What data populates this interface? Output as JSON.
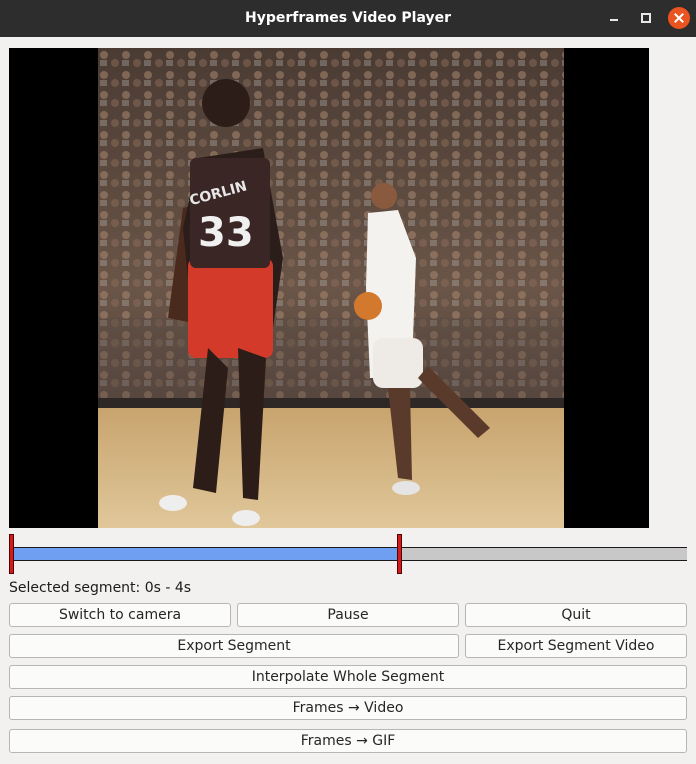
{
  "window": {
    "title": "Hyperframes Video Player",
    "controls": [
      "minimize-icon",
      "maximize-icon",
      "close-icon"
    ]
  },
  "player": {
    "jersey_name": "CORLIN",
    "jersey_number": "33"
  },
  "timeline": {
    "progress_fraction": 0.576,
    "segment_start_fraction": 0.0,
    "segment_end_fraction": 0.576,
    "fill_color": "#6f9ff0",
    "handle_color": "#d11c1c"
  },
  "segment": {
    "label": "Selected segment: 0s - 4s"
  },
  "buttons": {
    "switch_camera": "Switch to camera",
    "pause": "Pause",
    "quit": "Quit",
    "export_segment": "Export Segment",
    "export_segment_video": "Export Segment Video",
    "interpolate": "Interpolate Whole Segment",
    "frames_video": "Frames → Video",
    "frames_gif": "Frames → GIF"
  }
}
